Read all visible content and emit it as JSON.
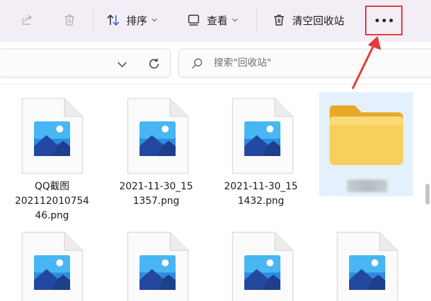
{
  "toolbar": {
    "sort_label": "排序",
    "view_label": "查看",
    "empty_bin_label": "清空回收站",
    "icons": [
      "share-icon",
      "delete-icon",
      "sort-icon",
      "view-icon",
      "trash-icon",
      "more-icon"
    ],
    "highlight_color": "#e23b3b"
  },
  "address_bar": {
    "path": "",
    "search_placeholder": "搜索\"回收站\""
  },
  "files": [
    {
      "name_lines": [
        "QQ截图",
        "202112010754",
        "46.png"
      ],
      "type": "image"
    },
    {
      "name_lines": [
        "2021-11-30_15",
        "1357.png"
      ],
      "type": "image"
    },
    {
      "name_lines": [
        "2021-11-30_15",
        "1432.png"
      ],
      "type": "image"
    },
    {
      "name_lines": [],
      "type": "folder",
      "selected": true
    },
    {
      "name_lines": [],
      "type": "image"
    },
    {
      "name_lines": [],
      "type": "image"
    },
    {
      "name_lines": [],
      "type": "image"
    },
    {
      "name_lines": [],
      "type": "image"
    }
  ],
  "colors": {
    "toolbar_bg": "#f3eef6",
    "selection_bg": "#e4f0fb",
    "folder_yellow": "#f5c84b"
  }
}
